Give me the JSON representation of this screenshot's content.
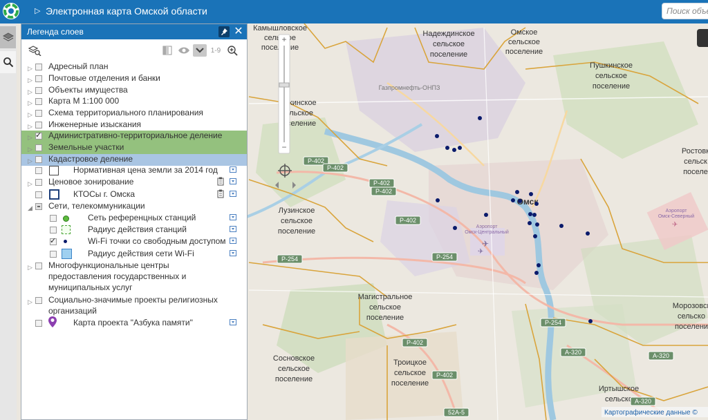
{
  "header": {
    "title": "Электронная карта Омской области",
    "search_placeholder": "Поиск объе"
  },
  "legend": {
    "title": "Легенда слоев",
    "tools": {
      "range_label": "1-9"
    },
    "layers": [
      {
        "label": "Адресный план",
        "checked": false
      },
      {
        "label": "Почтовые отделения и банки",
        "checked": false
      },
      {
        "label": "Объекты имущества",
        "checked": false
      },
      {
        "label": "Карта М 1:100 000",
        "checked": false
      },
      {
        "label": "Схема территориального планирования",
        "checked": false
      },
      {
        "label": "Инженерные изыскания",
        "checked": false
      },
      {
        "label": "Административно-территориальное деление",
        "checked": true
      },
      {
        "label": "Земельные участки",
        "checked": false
      },
      {
        "label": "Кадастровое деление",
        "checked": false
      },
      {
        "label": "Нормативная цена земли за 2014 год",
        "checked": false
      },
      {
        "label": "Ценовое зонирование",
        "checked": false
      },
      {
        "label": "КТОСы г. Омска",
        "checked": false
      },
      {
        "label": "Сети, телекоммуникации",
        "checked": "partial"
      },
      {
        "label": "Сеть референцных станций",
        "checked": false
      },
      {
        "label": "Радиус действия станций",
        "checked": false
      },
      {
        "label": "Wi-Fi точки со свободным доступом",
        "checked": true
      },
      {
        "label": "Радиус действия сети Wi-Fi",
        "checked": false
      },
      {
        "label_lines": [
          "Многофункциональные центры",
          "предоставления государственных и",
          "муниципальных услуг"
        ],
        "checked": false
      },
      {
        "label_lines": [
          "Социально-значимые проекты религиозных",
          "организаций"
        ],
        "checked": false
      },
      {
        "label": "Карта проекта \"Азбука памяти\"",
        "checked": false
      }
    ]
  },
  "map": {
    "labels": {
      "kamyshlov": [
        "Камышловское",
        "сельское",
        "поселение"
      ],
      "nadezhdin": [
        "Надеждинское",
        "сельское",
        "поселение"
      ],
      "omskoe": [
        "Омское",
        "сельское",
        "поселение"
      ],
      "pushkin": [
        "Пушкинское",
        "сельское",
        "поселение"
      ],
      "rostov": [
        "Ростовк",
        "сельск",
        "поселе"
      ],
      "lugin": [
        "Лужинское",
        "сельское",
        "поселение"
      ],
      "luzin": [
        "Лузинское",
        "сельское",
        "поселение"
      ],
      "magistral": [
        "Магистральное",
        "сельское",
        "поселение"
      ],
      "morozov": [
        "Морозовск",
        "сельско",
        "поселени"
      ],
      "sosnov": [
        "Сосновское",
        "сельское",
        "поселение"
      ],
      "troitsk": [
        "Троицкое",
        "сельское",
        "поселение"
      ],
      "irtysh": [
        "Иртышское",
        "сельско"
      ],
      "omsk": "Омск",
      "gazprom": "Газпромнефть-ОНПЗ",
      "airport_central": [
        "Аэропорт",
        "Омск-Центральный"
      ],
      "airport_north": [
        "Аэропорт",
        "Омск-Северный"
      ]
    },
    "roads": [
      "Р-402",
      "Р-402",
      "Р-402",
      "Р-402",
      "Р-402",
      "Р-402",
      "Р-402",
      "Р-254",
      "Р-254",
      "Р-254",
      "А-320",
      "А-320",
      "А-320",
      "52А-5"
    ],
    "attribution": "Картографические данные ©",
    "wifi_point_color": "#0a1a6b"
  }
}
